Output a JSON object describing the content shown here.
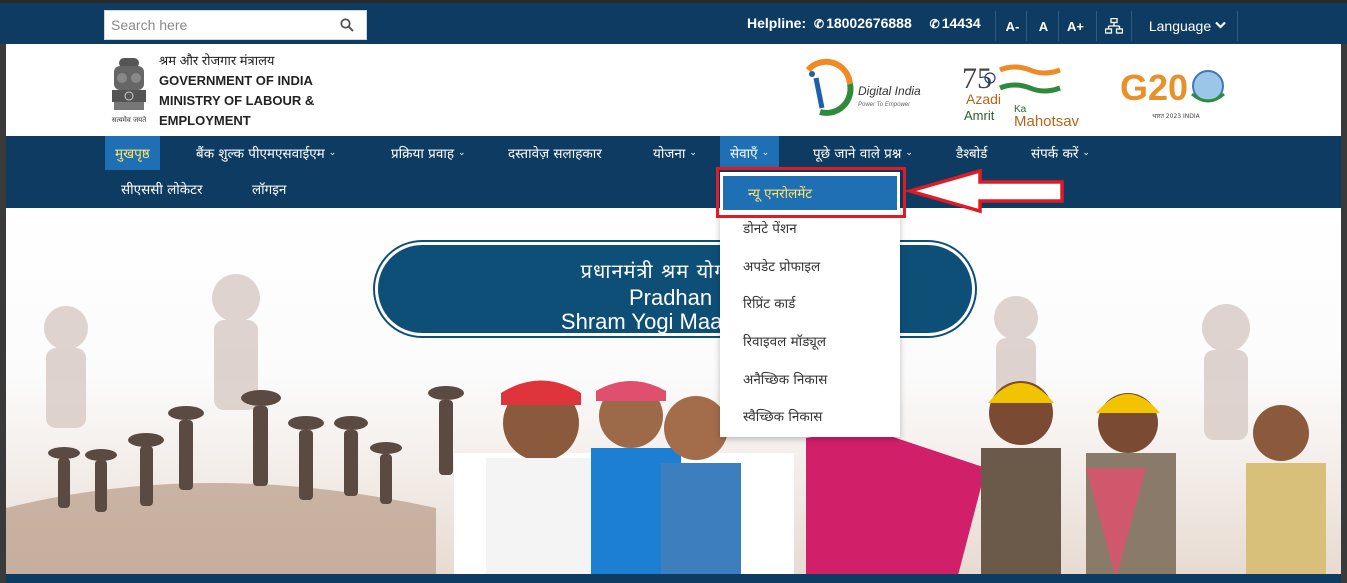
{
  "topbar": {
    "search_placeholder": "Search here",
    "helpline_label": "Helpline:",
    "phone1": "18002676888",
    "phone2": "14434",
    "font_decrease": "A-",
    "font_normal": "A",
    "font_increase": "A+",
    "language_label": "Language"
  },
  "header": {
    "ministry_hindi": "श्रम और रोजगार मंत्रालय",
    "ministry_line1": "GOVERNMENT OF INDIA",
    "ministry_line2": "MINISTRY OF LABOUR &",
    "ministry_line3": "EMPLOYMENT",
    "emblem_caption": "सत्यमेव जयते",
    "digital_india_title": "Digital India",
    "digital_india_tagline": "Power To Empower",
    "akam_line1": "Azadi",
    "akam_ka": "Ka",
    "akam_line2": "Amrit",
    "akam_line3": "Mahotsav",
    "g20_text": "G20",
    "g20_caption": "भारत 2023 INDIA"
  },
  "nav": {
    "items": [
      {
        "label": "मुखपृष्ठ",
        "active": true
      },
      {
        "label": "बैंक शुल्क पीएमएसवाईएम",
        "dropdown": true
      },
      {
        "label": "प्रक्रिया प्रवाह",
        "dropdown": true
      },
      {
        "label": "दस्तावेज़ सलाहकार"
      },
      {
        "label": "योजना",
        "dropdown": true
      },
      {
        "label": "सेवाएँ",
        "dropdown": true,
        "open": true
      },
      {
        "label": "पूछे जाने वाले प्रश्न",
        "dropdown": true
      },
      {
        "label": "डैश्बोर्ड"
      },
      {
        "label": "संपर्क करें",
        "dropdown": true
      },
      {
        "label": "सीएससी लोकेटर"
      },
      {
        "label": "लॉगइन"
      }
    ]
  },
  "services_dropdown": {
    "items": [
      "न्यू एनरोलमेंट",
      "डोनटे पेंशन",
      "अपडेट प्रोफाइल",
      "रिप्रिंट कार्ड",
      "रिवाइवल मॉड्यूल",
      "अनैच्छिक निकास",
      "स्वैच्छिक निकास"
    ]
  },
  "hero": {
    "title_hindi": "प्रधानमंत्री श्रम योगी मान",
    "title_en_line1": "Pradhan Man",
    "title_en_line2": "Shram Yogi Maandh"
  },
  "colors": {
    "navy": "#0e3b62",
    "nav_active": "#1f6fb5",
    "active_text": "#ffe36b",
    "annotation_red": "#e01b24"
  }
}
